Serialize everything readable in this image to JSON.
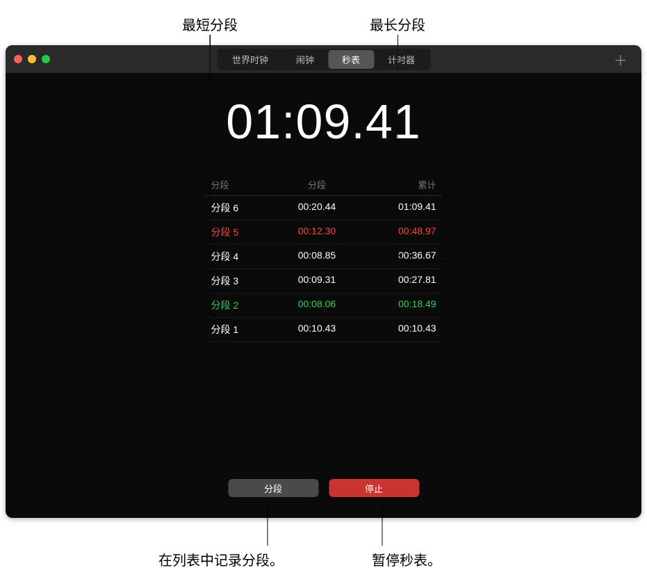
{
  "callouts": {
    "shortest_lap": "最短分段",
    "longest_lap": "最长分段",
    "record_lap": "在列表中记录分段。",
    "pause_stopwatch": "暂停秒表。"
  },
  "tabs": {
    "world_clock": "世界时钟",
    "alarm": "闹钟",
    "stopwatch": "秒表",
    "timer": "计时器"
  },
  "time_display": "01:09.41",
  "lap_headers": {
    "lap": "分段",
    "split": "分段",
    "total": "累计"
  },
  "laps": [
    {
      "name": "分段 6",
      "split": "00:20.44",
      "total": "01:09.41",
      "status": "normal"
    },
    {
      "name": "分段 5",
      "split": "00:12.30",
      "total": "00:48.97",
      "status": "longest"
    },
    {
      "name": "分段 4",
      "split": "00:08.85",
      "total": "00:36.67",
      "status": "normal"
    },
    {
      "name": "分段 3",
      "split": "00:09.31",
      "total": "00:27.81",
      "status": "normal"
    },
    {
      "name": "分段 2",
      "split": "00:08.06",
      "total": "00:18.49",
      "status": "shortest"
    },
    {
      "name": "分段 1",
      "split": "00:10.43",
      "total": "00:10.43",
      "status": "normal"
    }
  ],
  "buttons": {
    "lap": "分段",
    "stop": "停止"
  },
  "add_icon": "＋"
}
